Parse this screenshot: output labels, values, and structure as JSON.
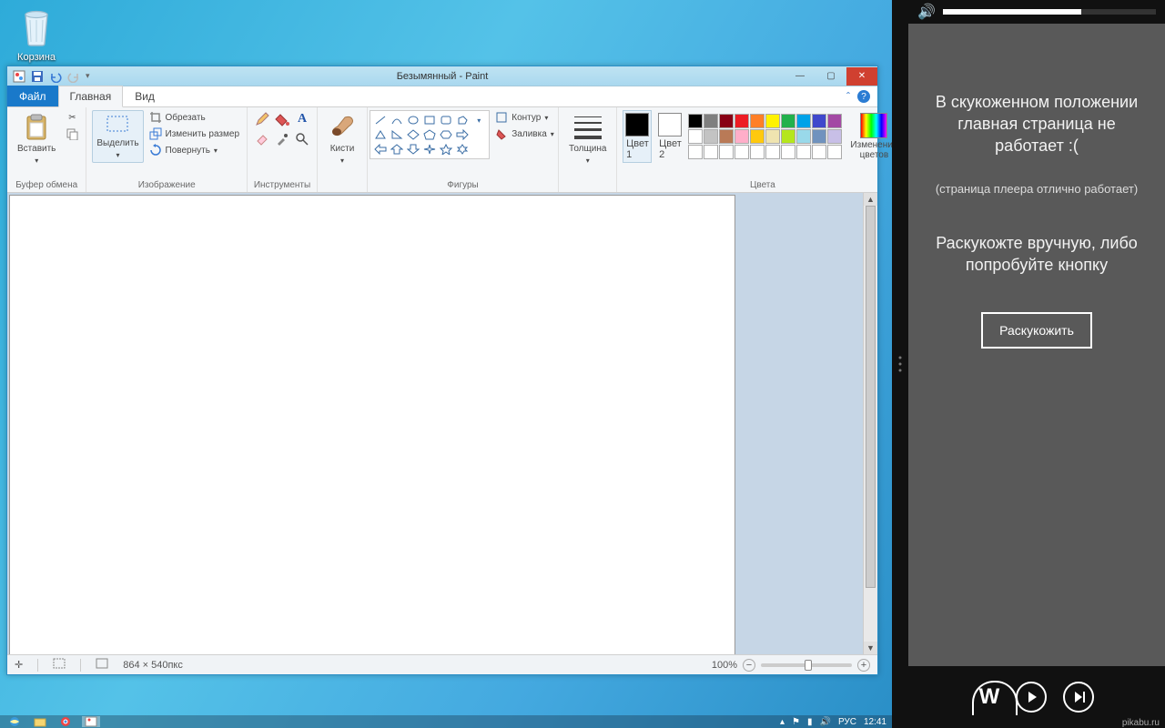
{
  "desktop": {
    "recycle_label": "Корзина"
  },
  "paint": {
    "title": "Безымянный - Paint",
    "tabs": {
      "file": "Файл",
      "home": "Главная",
      "view": "Вид"
    },
    "groups": {
      "clipboard": {
        "paste": "Вставить",
        "name": "Буфер обмена"
      },
      "image": {
        "select": "Выделить",
        "crop": "Обрезать",
        "resize": "Изменить размер",
        "rotate": "Повернуть",
        "name": "Изображение"
      },
      "tools": {
        "name": "Инструменты"
      },
      "brushes": {
        "label": "Кисти"
      },
      "shapes": {
        "outline": "Контур",
        "fill": "Заливка",
        "name": "Фигуры"
      },
      "thickness": {
        "label": "Толщина"
      },
      "colors": {
        "c1": "Цвет\n1",
        "c2": "Цвет\n2",
        "edit": "Изменение\nцветов",
        "name": "Цвета"
      }
    },
    "status": {
      "dims": "864 × 540пкс",
      "zoom": "100%"
    },
    "canvas_size": "864 × 540",
    "palette_row1": [
      "#000",
      "#7f7f7f",
      "#880015",
      "#ed1c24",
      "#ff7f27",
      "#fff200",
      "#22b14c",
      "#00a2e8",
      "#3f48cc",
      "#a349a4"
    ],
    "palette_row2": [
      "#fff",
      "#c3c3c3",
      "#b97a57",
      "#ffaec9",
      "#ffc90e",
      "#efe4b0",
      "#b5e61d",
      "#99d9ea",
      "#7092be",
      "#c8bfe7"
    ],
    "palette_row3": [
      "#fff",
      "#fff",
      "#fff",
      "#fff",
      "#fff",
      "#fff",
      "#fff",
      "#fff",
      "#fff",
      "#fff"
    ],
    "color1": "#000000",
    "color2": "#ffffff"
  },
  "taskbar": {
    "lang": "РУС",
    "time": "12:41"
  },
  "panel": {
    "msg": "В скукоженном положении главная страница не работает :(",
    "sub": "(страница плеера отлично работает)",
    "msg2": "Раскукожте вручную, либо попробуйте кнопку",
    "button": "Раскукожить",
    "volume_pct": 65
  },
  "watermark": "pikabu.ru"
}
